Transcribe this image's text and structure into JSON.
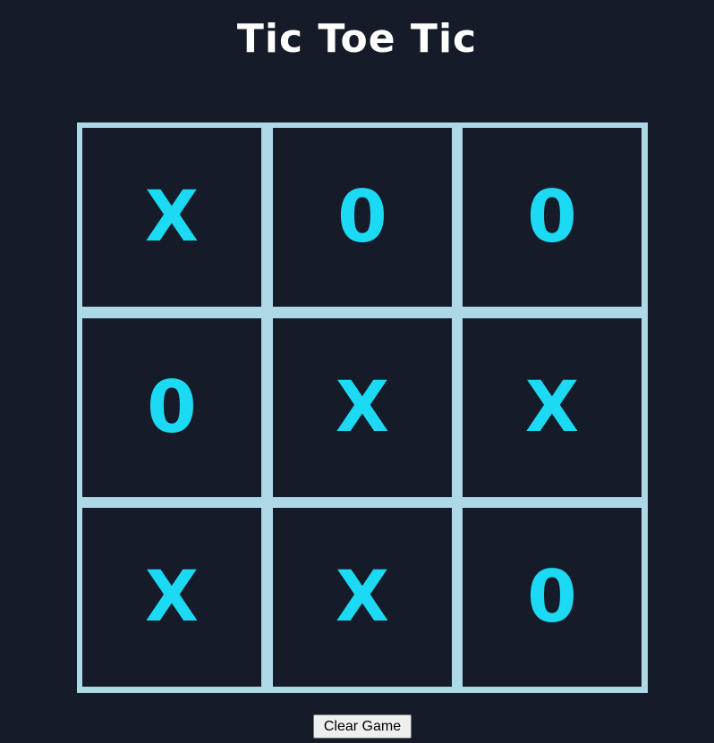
{
  "title": "Tic Toe Tic",
  "board": {
    "cells": [
      "X",
      "0",
      "0",
      "0",
      "X",
      "X",
      "X",
      "X",
      "0"
    ]
  },
  "controls": {
    "clear_label": "Clear Game"
  },
  "colors": {
    "background": "#151b28",
    "grid": "#add8e6",
    "mark": "#1cd9f4",
    "title": "#ffffff"
  }
}
